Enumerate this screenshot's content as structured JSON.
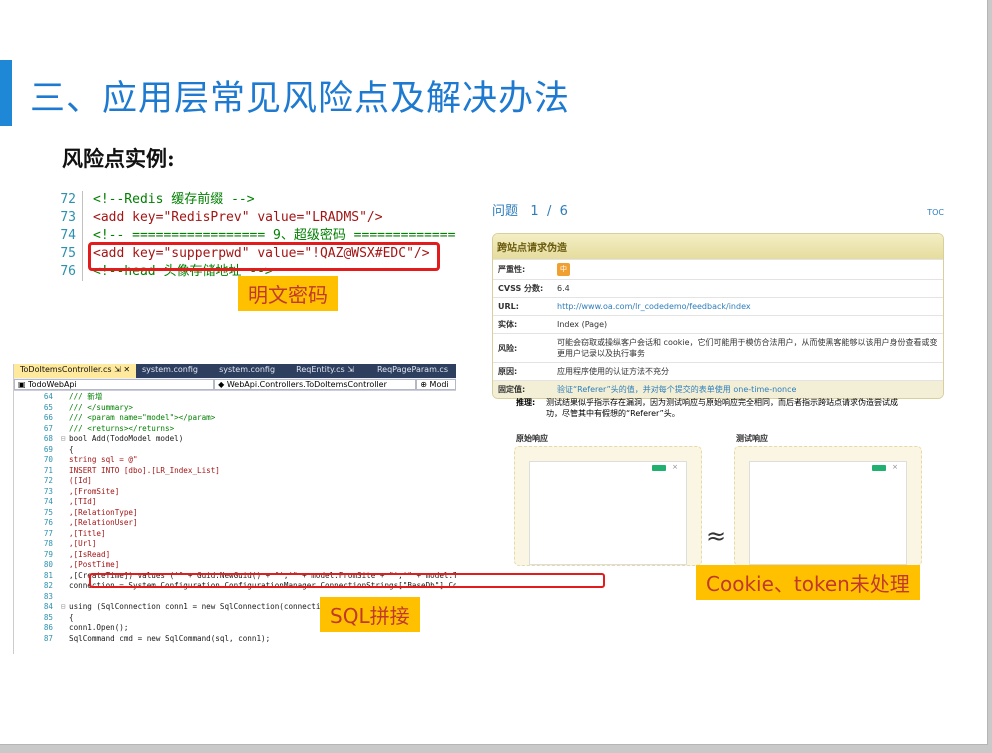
{
  "slide": {
    "title": "三、应用层常见风险点及解决办法",
    "subtitle": "风险点实例:"
  },
  "config_snippet": {
    "lines": [
      {
        "num": "72",
        "text": "<!--Redis 缓存前缀 -->"
      },
      {
        "num": "73",
        "text": "<add key=\"RedisPrev\" value=\"LRADMS\"/>"
      },
      {
        "num": "74",
        "text": "<!-- ================= 9、超级密码 ================"
      },
      {
        "num": "75",
        "text": "<add key=\"supperpwd\" value=\"!QAZ@WSX#EDC\"/>"
      },
      {
        "num": "76",
        "text": "<!--head 头像存储地址 -->"
      }
    ],
    "label": "明文密码"
  },
  "report": {
    "issue_label": "问题",
    "issue_index": "1",
    "issue_sep": "/",
    "issue_total": "6",
    "toc": "TOC",
    "title": "跨站点请求伪造",
    "rows": [
      {
        "key": "严重性:",
        "value": "中",
        "type": "badge"
      },
      {
        "key": "CVSS 分数:",
        "value": "6.4",
        "type": "text"
      },
      {
        "key": "URL:",
        "value": "http://www.oa.com/lr_codedemo/feedback/index",
        "type": "link"
      },
      {
        "key": "实体:",
        "value": "Index (Page)",
        "type": "text"
      },
      {
        "key": "风险:",
        "value": "可能会窃取或操纵客户会话和 cookie，它们可能用于模仿合法用户，从而使黑客能够以该用户身份查看或变更用户记录以及执行事务",
        "type": "text"
      },
      {
        "key": "原因:",
        "value": "应用程序使用的认证方法不充分",
        "type": "text"
      },
      {
        "key": "固定值:",
        "value": "验证“Referer”头的值，并对每个提交的表单使用 one-time-nonce",
        "type": "link"
      }
    ],
    "reasoning_key": "推理:",
    "reasoning": "测试结果似乎指示存在漏洞，因为测试响应与原始响应完全相同，而后者指示跨站点请求伪造尝试成功，尽管其中有假想的“Referer”头。",
    "original_response": "原始响应",
    "test_response": "测试响应",
    "approx_symbol": "≈",
    "close_glyph": "×",
    "label": "Cookie、token未处理"
  },
  "ide": {
    "tabs": [
      {
        "label": "ToDoItemsController.cs ⇲  ✕",
        "active": true
      },
      {
        "label": "system.config",
        "active": false
      },
      {
        "label": "system.config",
        "active": false
      },
      {
        "label": "ReqEntity.cs  ⇲",
        "active": false
      },
      {
        "label": "ReqPageParam.cs",
        "active": false
      }
    ],
    "nav_project": "TodoWebApi",
    "nav_class": "WebApi.Controllers.ToDoItemsController",
    "nav_member": "Modi",
    "lines": [
      {
        "num": "64",
        "gut": "",
        "text": "    /// 新增"
      },
      {
        "num": "65",
        "gut": "",
        "text": "    /// </summary>"
      },
      {
        "num": "66",
        "gut": "",
        "text": "    /// <param name=\"model\"></param>"
      },
      {
        "num": "67",
        "gut": "",
        "text": "    /// <returns></returns>"
      },
      {
        "num": "68",
        "gut": "⊟",
        "text": "    bool Add(TodoModel model)"
      },
      {
        "num": "69",
        "gut": "",
        "text": "    {"
      },
      {
        "num": "70",
        "gut": "",
        "text": "        string sql = @\""
      },
      {
        "num": "71",
        "gut": "",
        "text": "        INSERT INTO [dbo].[LR_Index_List]"
      },
      {
        "num": "72",
        "gut": "",
        "text": "       ([Id]"
      },
      {
        "num": "73",
        "gut": "",
        "text": "       ,[FromSite]"
      },
      {
        "num": "74",
        "gut": "",
        "text": "       ,[TId]"
      },
      {
        "num": "75",
        "gut": "",
        "text": "       ,[RelationType]"
      },
      {
        "num": "76",
        "gut": "",
        "text": "       ,[RelationUser]"
      },
      {
        "num": "77",
        "gut": "",
        "text": "       ,[Title]"
      },
      {
        "num": "78",
        "gut": "",
        "text": "       ,[Url]"
      },
      {
        "num": "79",
        "gut": "",
        "text": "       ,[IsRead]"
      },
      {
        "num": "80",
        "gut": "",
        "text": "       ,[PostTime]"
      },
      {
        "num": "81",
        "gut": "",
        "text": "       ,[CreateTime]) values ('\" + Guid.NewGuid() + \"','\" + model.FromSite + \"','\" + model.TodoId + \"','\" + (model.TodoType =="
      },
      {
        "num": "82",
        "gut": "",
        "text": "        connection = System.Configuration.ConfigurationManager.ConnectionStrings[\"BaseDb\"].ConnectionString;"
      },
      {
        "num": "83",
        "gut": "",
        "text": ""
      },
      {
        "num": "84",
        "gut": "⊟",
        "text": "        using (SqlConnection conn1 = new SqlConnection(connection))"
      },
      {
        "num": "85",
        "gut": "",
        "text": "        {"
      },
      {
        "num": "86",
        "gut": "",
        "text": "            conn1.Open();"
      },
      {
        "num": "87",
        "gut": "",
        "text": "            SqlCommand cmd = new SqlCommand(sql, conn1);"
      }
    ],
    "label": "SQL拼接"
  }
}
